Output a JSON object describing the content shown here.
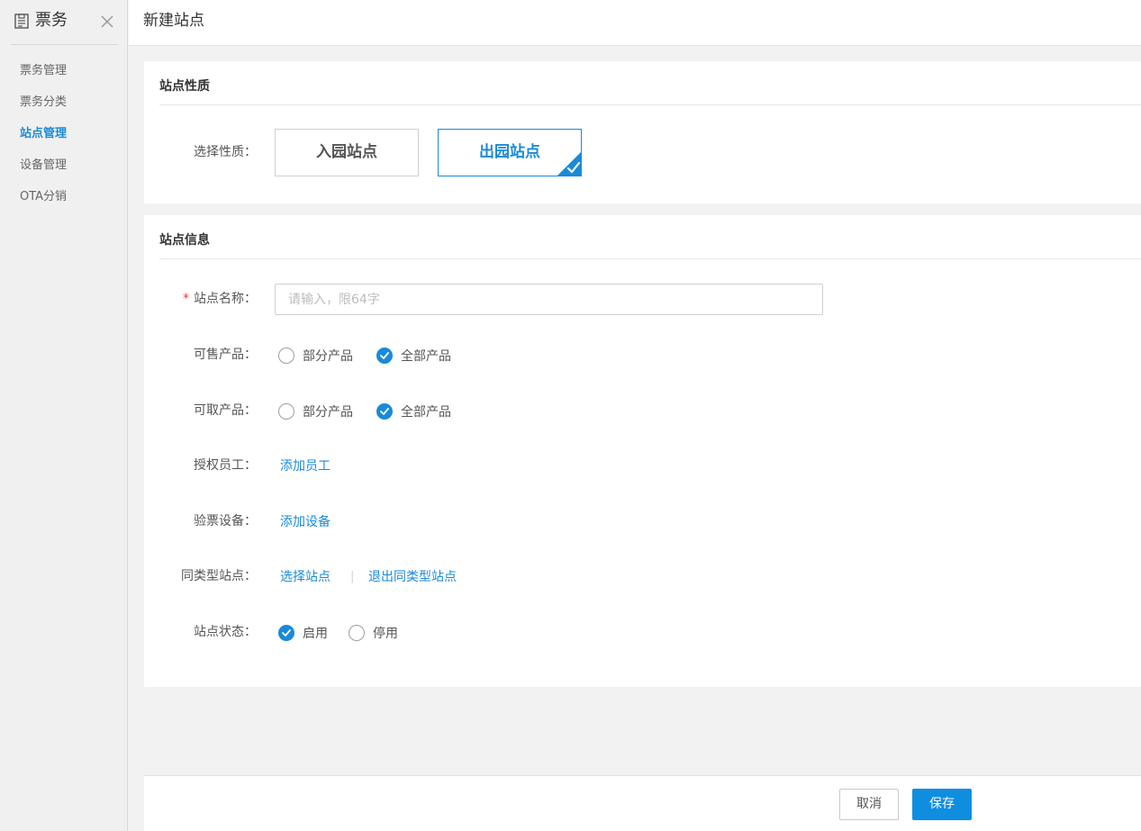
{
  "sidebar": {
    "title": "票务",
    "items": [
      {
        "label": "票务管理"
      },
      {
        "label": "票务分类"
      },
      {
        "label": "站点管理"
      },
      {
        "label": "设备管理"
      },
      {
        "label": "OTA分销"
      }
    ],
    "active_index": 2
  },
  "header": {
    "title": "新建站点"
  },
  "section_type": {
    "title": "站点性质",
    "label": "选择性质：",
    "options": [
      {
        "label": "入园站点",
        "selected": false
      },
      {
        "label": "出园站点",
        "selected": true
      }
    ]
  },
  "section_info": {
    "title": "站点信息",
    "name": {
      "required_mark": "*",
      "label": "站点名称：",
      "placeholder": "请输入，限64字",
      "value": ""
    },
    "sellable": {
      "label": "可售产品：",
      "options": [
        {
          "label": "部分产品",
          "checked": false
        },
        {
          "label": "全部产品",
          "checked": true
        }
      ]
    },
    "pickup": {
      "label": "可取产品：",
      "options": [
        {
          "label": "部分产品",
          "checked": false
        },
        {
          "label": "全部产品",
          "checked": true
        }
      ]
    },
    "staff": {
      "label": "授权员工：",
      "link": "添加员工"
    },
    "device": {
      "label": "验票设备：",
      "link": "添加设备"
    },
    "same_type": {
      "label": "同类型站点：",
      "select_link": "选择站点",
      "separator": "|",
      "exit_link": "退出同类型站点"
    },
    "status": {
      "label": "站点状态：",
      "options": [
        {
          "label": "启用",
          "checked": true
        },
        {
          "label": "停用",
          "checked": false
        }
      ]
    }
  },
  "footer": {
    "cancel_label": "取消",
    "save_label": "保存"
  },
  "colors": {
    "accent": "#1a8ad8",
    "required": "#e53935",
    "save_button": "#0f8ee0"
  }
}
